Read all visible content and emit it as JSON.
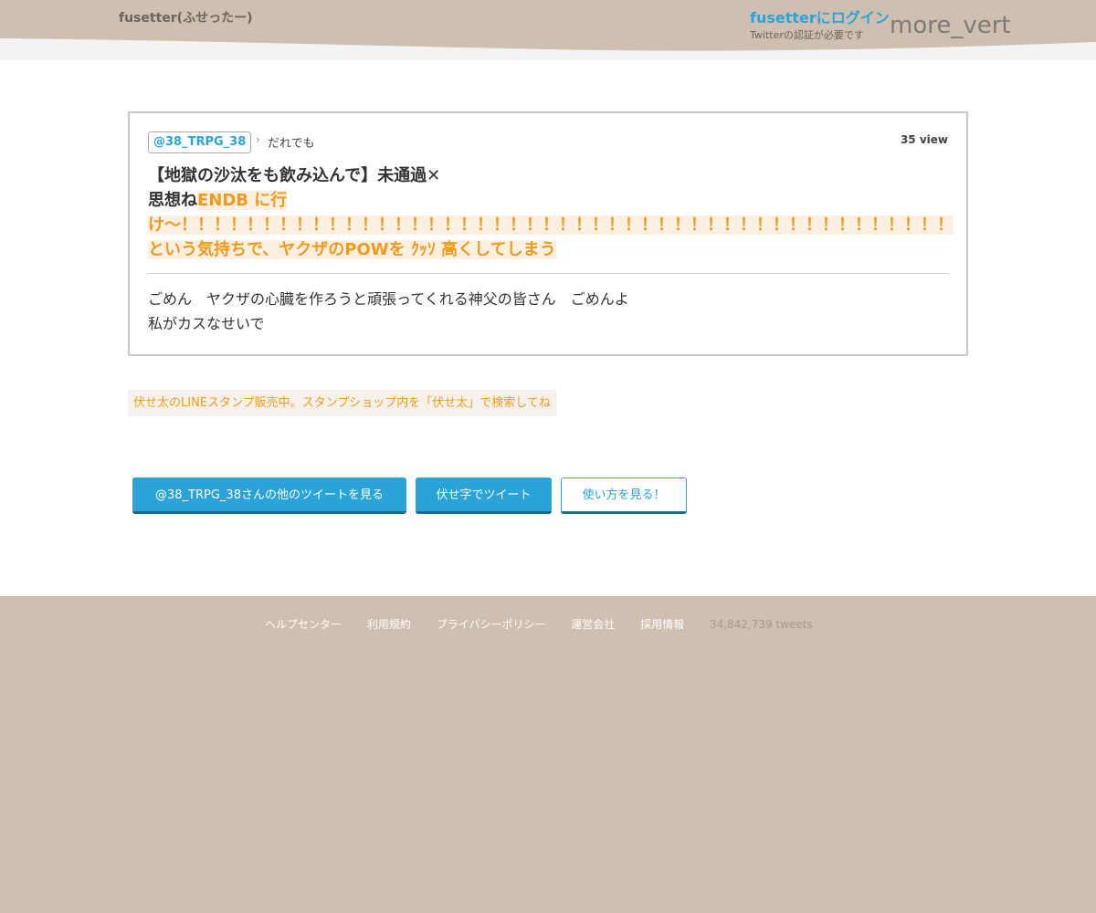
{
  "header": {
    "brand": "fusetter(ふせったー)",
    "login_label": "fusetterにログイン",
    "login_note": "Twitterの認証が必要です",
    "menu_icon_text": "more_vert",
    "bg_color": "#cfbfb1",
    "accent_color": "#2aa3d9"
  },
  "tweet": {
    "user": "@38_TRPG_38",
    "audience": "だれでも",
    "views": "35 view",
    "title_plain_1": "【地獄の沙汰をも飲み込んで】未通過✕",
    "title_plain_2": "思想ね",
    "title_highlight": "ENDB に行け〜！！！！！！！！！！！！！！！！！！！！！！！！！！！！！！！！！！！！！！！！！！！！！！！という気持ちで、ヤクザのPOWを ｸｯｿ 高くしてしまう",
    "body_line_1": "ごめん　ヤクザの心臓を作ろうと頑張ってくれる神父の皆さん　ごめんよ",
    "body_line_2": "私がカスなせいで",
    "highlight_color": "#f39a1e"
  },
  "promo": {
    "text": "伏せ太のLINEスタンプ販売中。スタンプショップ内を「伏せ太」で検索してね"
  },
  "actions": {
    "other_tweets": "@38_TRPG_38さんの他のツイートを見る",
    "tweet_fuse": "伏せ字でツイート",
    "how_to": "使い方を見る！"
  },
  "footer": {
    "links": [
      "ヘルプセンター",
      "利用規約",
      "プライバシーポリシー",
      "運営会社",
      "採用情報"
    ],
    "tweet_count": "34,842,739 tweets"
  }
}
